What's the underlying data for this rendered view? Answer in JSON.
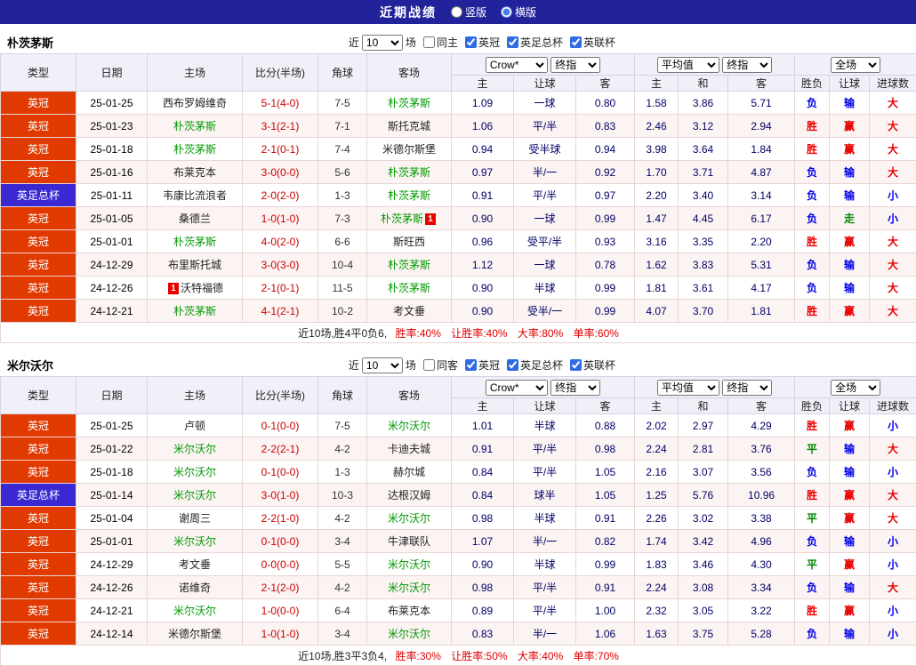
{
  "top_bar": {
    "title": "近期战绩",
    "vertical_label": "竖版",
    "horizontal_label": "横版",
    "selected": "横版"
  },
  "table_head": {
    "type": "类型",
    "date": "日期",
    "home": "主场",
    "score": "比分(半场)",
    "corners": "角球",
    "away": "客场",
    "selects": {
      "bookmaker": "Crow*",
      "final1": "终指",
      "average": "平均值",
      "final2": "终指",
      "scope": "全场"
    },
    "asia_sub": [
      "主",
      "让球",
      "客"
    ],
    "euro_sub": [
      "主",
      "和",
      "客"
    ],
    "result_sub": [
      "胜负",
      "让球",
      "进球数"
    ]
  },
  "colors": {
    "league_badge": "#e13a00",
    "cup_badge": "#3a28d2",
    "win_red": "#e60000",
    "draw_green": "#008800",
    "loss_blue": "#0000e6",
    "score_red": "#cc0000",
    "focus_team_green": "#009900",
    "odds_navy": "#000066"
  },
  "result_color_map": {
    "胜": "win_red",
    "赢": "win_red",
    "大": "win_red",
    "平": "draw_green",
    "走": "draw_green",
    "负": "loss_blue",
    "输": "loss_blue",
    "小": "loss_blue"
  },
  "sections": [
    {
      "team": "朴茨茅斯",
      "filter": {
        "near": "近",
        "count": "10",
        "games": "场",
        "same": "同主",
        "leagues": [
          "英冠",
          "英足总杯",
          "英联杯"
        ]
      },
      "rows": [
        {
          "league": "英冠",
          "cup": false,
          "date": "25-01-25",
          "home": "西布罗姆维奇",
          "home_focus": false,
          "home_card": "",
          "score": "5-1(4-0)",
          "corners": "7-5",
          "away": "朴茨茅斯",
          "away_focus": true,
          "away_card": "",
          "asia": [
            "1.09",
            "一球",
            "0.80"
          ],
          "euro": [
            "1.58",
            "3.86",
            "5.71"
          ],
          "result": [
            "负",
            "输",
            "大"
          ]
        },
        {
          "league": "英冠",
          "cup": false,
          "date": "25-01-23",
          "home": "朴茨茅斯",
          "home_focus": true,
          "home_card": "",
          "score": "3-1(2-1)",
          "corners": "7-1",
          "away": "斯托克城",
          "away_focus": false,
          "away_card": "",
          "asia": [
            "1.06",
            "平/半",
            "0.83"
          ],
          "euro": [
            "2.46",
            "3.12",
            "2.94"
          ],
          "result": [
            "胜",
            "赢",
            "大"
          ]
        },
        {
          "league": "英冠",
          "cup": false,
          "date": "25-01-18",
          "home": "朴茨茅斯",
          "home_focus": true,
          "home_card": "",
          "score": "2-1(0-1)",
          "corners": "7-4",
          "away": "米德尔斯堡",
          "away_focus": false,
          "away_card": "",
          "asia": [
            "0.94",
            "受半球",
            "0.94"
          ],
          "euro": [
            "3.98",
            "3.64",
            "1.84"
          ],
          "result": [
            "胜",
            "赢",
            "大"
          ]
        },
        {
          "league": "英冠",
          "cup": false,
          "date": "25-01-16",
          "home": "布莱克本",
          "home_focus": false,
          "home_card": "",
          "score": "3-0(0-0)",
          "corners": "5-6",
          "away": "朴茨茅斯",
          "away_focus": true,
          "away_card": "",
          "asia": [
            "0.97",
            "半/一",
            "0.92"
          ],
          "euro": [
            "1.70",
            "3.71",
            "4.87"
          ],
          "result": [
            "负",
            "输",
            "大"
          ]
        },
        {
          "league": "英足总杯",
          "cup": true,
          "date": "25-01-11",
          "home": "韦康比流浪者",
          "home_focus": false,
          "home_card": "",
          "score": "2-0(2-0)",
          "corners": "1-3",
          "away": "朴茨茅斯",
          "away_focus": true,
          "away_card": "",
          "asia": [
            "0.91",
            "平/半",
            "0.97"
          ],
          "euro": [
            "2.20",
            "3.40",
            "3.14"
          ],
          "result": [
            "负",
            "输",
            "小"
          ]
        },
        {
          "league": "英冠",
          "cup": false,
          "date": "25-01-05",
          "home": "桑德兰",
          "home_focus": false,
          "home_card": "",
          "score": "1-0(1-0)",
          "corners": "7-3",
          "away": "朴茨茅斯",
          "away_focus": true,
          "away_card": "1",
          "asia": [
            "0.90",
            "一球",
            "0.99"
          ],
          "euro": [
            "1.47",
            "4.45",
            "6.17"
          ],
          "result": [
            "负",
            "走",
            "小"
          ]
        },
        {
          "league": "英冠",
          "cup": false,
          "date": "25-01-01",
          "home": "朴茨茅斯",
          "home_focus": true,
          "home_card": "",
          "score": "4-0(2-0)",
          "corners": "6-6",
          "away": "斯旺西",
          "away_focus": false,
          "away_card": "",
          "asia": [
            "0.96",
            "受平/半",
            "0.93"
          ],
          "euro": [
            "3.16",
            "3.35",
            "2.20"
          ],
          "result": [
            "胜",
            "赢",
            "大"
          ]
        },
        {
          "league": "英冠",
          "cup": false,
          "date": "24-12-29",
          "home": "布里斯托城",
          "home_focus": false,
          "home_card": "",
          "score": "3-0(3-0)",
          "corners": "10-4",
          "away": "朴茨茅斯",
          "away_focus": true,
          "away_card": "",
          "asia": [
            "1.12",
            "一球",
            "0.78"
          ],
          "euro": [
            "1.62",
            "3.83",
            "5.31"
          ],
          "result": [
            "负",
            "输",
            "大"
          ]
        },
        {
          "league": "英冠",
          "cup": false,
          "date": "24-12-26",
          "home": "沃特福德",
          "home_focus": false,
          "home_card": "1",
          "score": "2-1(0-1)",
          "corners": "11-5",
          "away": "朴茨茅斯",
          "away_focus": true,
          "away_card": "",
          "asia": [
            "0.90",
            "半球",
            "0.99"
          ],
          "euro": [
            "1.81",
            "3.61",
            "4.17"
          ],
          "result": [
            "负",
            "输",
            "大"
          ]
        },
        {
          "league": "英冠",
          "cup": false,
          "date": "24-12-21",
          "home": "朴茨茅斯",
          "home_focus": true,
          "home_card": "",
          "score": "4-1(2-1)",
          "corners": "10-2",
          "away": "考文垂",
          "away_focus": false,
          "away_card": "",
          "asia": [
            "0.90",
            "受半/一",
            "0.99"
          ],
          "euro": [
            "4.07",
            "3.70",
            "1.81"
          ],
          "result": [
            "胜",
            "赢",
            "大"
          ]
        }
      ],
      "summary": {
        "intro": "近10场,胜4平0负6,",
        "stats": "胜率:40% 让胜率:40% 大率:80% 单率:60%"
      }
    },
    {
      "team": "米尔沃尔",
      "filter": {
        "near": "近",
        "count": "10",
        "games": "场",
        "same": "同客",
        "leagues": [
          "英冠",
          "英足总杯",
          "英联杯"
        ]
      },
      "rows": [
        {
          "league": "英冠",
          "cup": false,
          "date": "25-01-25",
          "home": "卢顿",
          "home_focus": false,
          "home_card": "",
          "score": "0-1(0-0)",
          "corners": "7-5",
          "away": "米尔沃尔",
          "away_focus": true,
          "away_card": "",
          "asia": [
            "1.01",
            "半球",
            "0.88"
          ],
          "euro": [
            "2.02",
            "2.97",
            "4.29"
          ],
          "result": [
            "胜",
            "赢",
            "小"
          ]
        },
        {
          "league": "英冠",
          "cup": false,
          "date": "25-01-22",
          "home": "米尔沃尔",
          "home_focus": true,
          "home_card": "",
          "score": "2-2(2-1)",
          "corners": "4-2",
          "away": "卡迪夫城",
          "away_focus": false,
          "away_card": "",
          "asia": [
            "0.91",
            "平/半",
            "0.98"
          ],
          "euro": [
            "2.24",
            "2.81",
            "3.76"
          ],
          "result": [
            "平",
            "输",
            "大"
          ]
        },
        {
          "league": "英冠",
          "cup": false,
          "date": "25-01-18",
          "home": "米尔沃尔",
          "home_focus": true,
          "home_card": "",
          "score": "0-1(0-0)",
          "corners": "1-3",
          "away": "赫尔城",
          "away_focus": false,
          "away_card": "",
          "asia": [
            "0.84",
            "平/半",
            "1.05"
          ],
          "euro": [
            "2.16",
            "3.07",
            "3.56"
          ],
          "result": [
            "负",
            "输",
            "小"
          ]
        },
        {
          "league": "英足总杯",
          "cup": true,
          "date": "25-01-14",
          "home": "米尔沃尔",
          "home_focus": true,
          "home_card": "",
          "score": "3-0(1-0)",
          "corners": "10-3",
          "away": "达根汉姆",
          "away_focus": false,
          "away_card": "",
          "asia": [
            "0.84",
            "球半",
            "1.05"
          ],
          "euro": [
            "1.25",
            "5.76",
            "10.96"
          ],
          "result": [
            "胜",
            "赢",
            "大"
          ]
        },
        {
          "league": "英冠",
          "cup": false,
          "date": "25-01-04",
          "home": "谢周三",
          "home_focus": false,
          "home_card": "",
          "score": "2-2(1-0)",
          "corners": "4-2",
          "away": "米尔沃尔",
          "away_focus": true,
          "away_card": "",
          "asia": [
            "0.98",
            "半球",
            "0.91"
          ],
          "euro": [
            "2.26",
            "3.02",
            "3.38"
          ],
          "result": [
            "平",
            "赢",
            "大"
          ]
        },
        {
          "league": "英冠",
          "cup": false,
          "date": "25-01-01",
          "home": "米尔沃尔",
          "home_focus": true,
          "home_card": "",
          "score": "0-1(0-0)",
          "corners": "3-4",
          "away": "牛津联队",
          "away_focus": false,
          "away_card": "",
          "asia": [
            "1.07",
            "半/一",
            "0.82"
          ],
          "euro": [
            "1.74",
            "3.42",
            "4.96"
          ],
          "result": [
            "负",
            "输",
            "小"
          ]
        },
        {
          "league": "英冠",
          "cup": false,
          "date": "24-12-29",
          "home": "考文垂",
          "home_focus": false,
          "home_card": "",
          "score": "0-0(0-0)",
          "corners": "5-5",
          "away": "米尔沃尔",
          "away_focus": true,
          "away_card": "",
          "asia": [
            "0.90",
            "半球",
            "0.99"
          ],
          "euro": [
            "1.83",
            "3.46",
            "4.30"
          ],
          "result": [
            "平",
            "赢",
            "小"
          ]
        },
        {
          "league": "英冠",
          "cup": false,
          "date": "24-12-26",
          "home": "诺维奇",
          "home_focus": false,
          "home_card": "",
          "score": "2-1(2-0)",
          "corners": "4-2",
          "away": "米尔沃尔",
          "away_focus": true,
          "away_card": "",
          "asia": [
            "0.98",
            "平/半",
            "0.91"
          ],
          "euro": [
            "2.24",
            "3.08",
            "3.34"
          ],
          "result": [
            "负",
            "输",
            "大"
          ]
        },
        {
          "league": "英冠",
          "cup": false,
          "date": "24-12-21",
          "home": "米尔沃尔",
          "home_focus": true,
          "home_card": "",
          "score": "1-0(0-0)",
          "corners": "6-4",
          "away": "布莱克本",
          "away_focus": false,
          "away_card": "",
          "asia": [
            "0.89",
            "平/半",
            "1.00"
          ],
          "euro": [
            "2.32",
            "3.05",
            "3.22"
          ],
          "result": [
            "胜",
            "赢",
            "小"
          ]
        },
        {
          "league": "英冠",
          "cup": false,
          "date": "24-12-14",
          "home": "米德尔斯堡",
          "home_focus": false,
          "home_card": "",
          "score": "1-0(1-0)",
          "corners": "3-4",
          "away": "米尔沃尔",
          "away_focus": true,
          "away_card": "",
          "asia": [
            "0.83",
            "半/一",
            "1.06"
          ],
          "euro": [
            "1.63",
            "3.75",
            "5.28"
          ],
          "result": [
            "负",
            "输",
            "小"
          ]
        }
      ],
      "summary": {
        "intro": "近10场,胜3平3负4,",
        "stats": "胜率:30% 让胜率:50% 大率:40% 单率:70%"
      }
    }
  ]
}
